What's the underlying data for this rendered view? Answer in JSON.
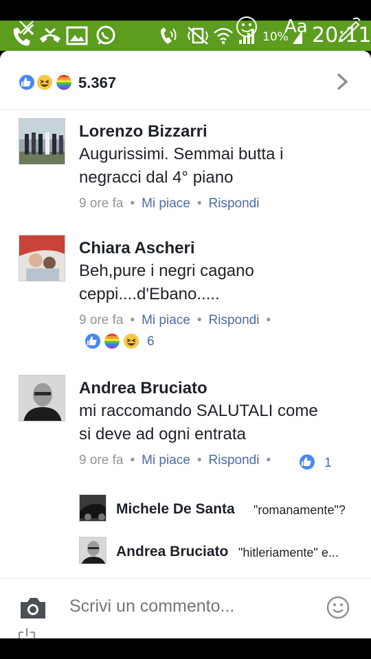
{
  "status_bar": {
    "battery_percent": "10%",
    "time": "20:11",
    "font_label": "Aa"
  },
  "reactions": {
    "icons": [
      "like-icon",
      "haha-icon",
      "rainbow-icon"
    ],
    "count": "5.367"
  },
  "comments": [
    {
      "author": "Lorenzo Bizzarri",
      "text_lines": [
        "Augurissimi. Semmai butta i",
        "negracci dal 4° piano"
      ],
      "time": "9 ore fa",
      "like_label": "Mi piace",
      "reply_label": "Rispondi"
    },
    {
      "author": "Chiara Ascheri",
      "text_lines": [
        "Beh,pure i negri cagano",
        "ceppi....d'Ebano....."
      ],
      "time": "9 ore fa",
      "like_label": "Mi piace",
      "reply_label": "Rispondi",
      "reaction_icons": [
        "like-icon",
        "rainbow-icon",
        "haha-icon"
      ],
      "reaction_count": "6"
    },
    {
      "author": "Andrea Bruciato",
      "text_lines": [
        "mi raccomando SALUTALI come",
        "si deve ad ogni entrata"
      ],
      "time": "9 ore fa",
      "like_label": "Mi piace",
      "reply_label": "Rispondi",
      "reaction_icons": [
        "like-icon"
      ],
      "reaction_count": "1"
    }
  ],
  "replies": [
    {
      "author": "Michele De Santa",
      "text": "\"romanamente\"?"
    },
    {
      "author": "Andrea Bruciato",
      "text": "\"hitleriamente\" e..."
    }
  ],
  "composer": {
    "placeholder": "Scrivi un commento..."
  },
  "colors": {
    "status_green": "#5c9c1f",
    "link_blue": "#4b6aa6",
    "meta_gray": "#90949c",
    "like_blue": "#4a87f0"
  }
}
